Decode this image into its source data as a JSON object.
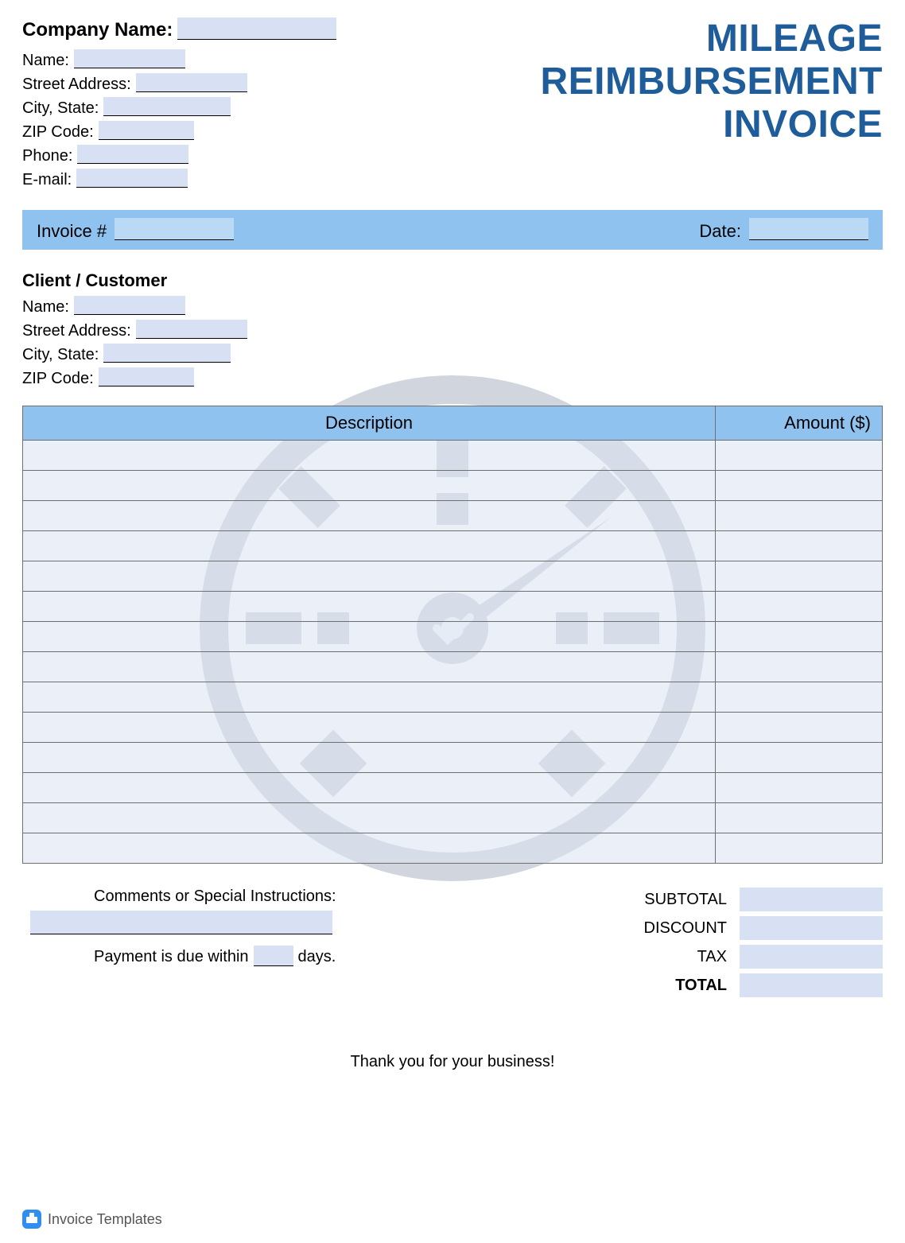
{
  "title": {
    "line1": "MILEAGE",
    "line2": "REIMBURSEMENT",
    "line3": "INVOICE"
  },
  "company": {
    "name_label": "Company Name:",
    "name_value": "",
    "contact_name_label": "Name:",
    "contact_name_value": "",
    "street_label": "Street Address:",
    "street_value": "",
    "city_state_label": "City, State:",
    "city_state_value": "",
    "zip_label": "ZIP Code:",
    "zip_value": "",
    "phone_label": "Phone:",
    "phone_value": "",
    "email_label": "E-mail:",
    "email_value": ""
  },
  "invoice_bar": {
    "invoice_no_label": "Invoice #",
    "invoice_no_value": "",
    "date_label": "Date:",
    "date_value": ""
  },
  "client": {
    "heading": "Client / Customer",
    "name_label": "Name:",
    "name_value": "",
    "street_label": "Street Address:",
    "street_value": "",
    "city_state_label": "City, State:",
    "city_state_value": "",
    "zip_label": "ZIP Code:",
    "zip_value": ""
  },
  "items": {
    "headers": {
      "description": "Description",
      "amount": "Amount ($)"
    },
    "rows": [
      {
        "description": "",
        "amount": ""
      },
      {
        "description": "",
        "amount": ""
      },
      {
        "description": "",
        "amount": ""
      },
      {
        "description": "",
        "amount": ""
      },
      {
        "description": "",
        "amount": ""
      },
      {
        "description": "",
        "amount": ""
      },
      {
        "description": "",
        "amount": ""
      },
      {
        "description": "",
        "amount": ""
      },
      {
        "description": "",
        "amount": ""
      },
      {
        "description": "",
        "amount": ""
      },
      {
        "description": "",
        "amount": ""
      },
      {
        "description": "",
        "amount": ""
      },
      {
        "description": "",
        "amount": ""
      },
      {
        "description": "",
        "amount": ""
      }
    ]
  },
  "comments": {
    "heading": "Comments or Special Instructions:",
    "value": "",
    "payment_prefix": "Payment is due within",
    "payment_days_value": "",
    "payment_suffix": "days."
  },
  "totals": {
    "subtotal_label": "SUBTOTAL",
    "subtotal_value": "",
    "discount_label": "DISCOUNT",
    "discount_value": "",
    "tax_label": "TAX",
    "tax_value": "",
    "total_label": "TOTAL",
    "total_value": ""
  },
  "thanks": "Thank you for your business!",
  "footer_brand": "Invoice Templates",
  "colors": {
    "accent": "#1f5d9a",
    "bar": "#8fc2ef",
    "field_fill": "#d8e1f3"
  }
}
